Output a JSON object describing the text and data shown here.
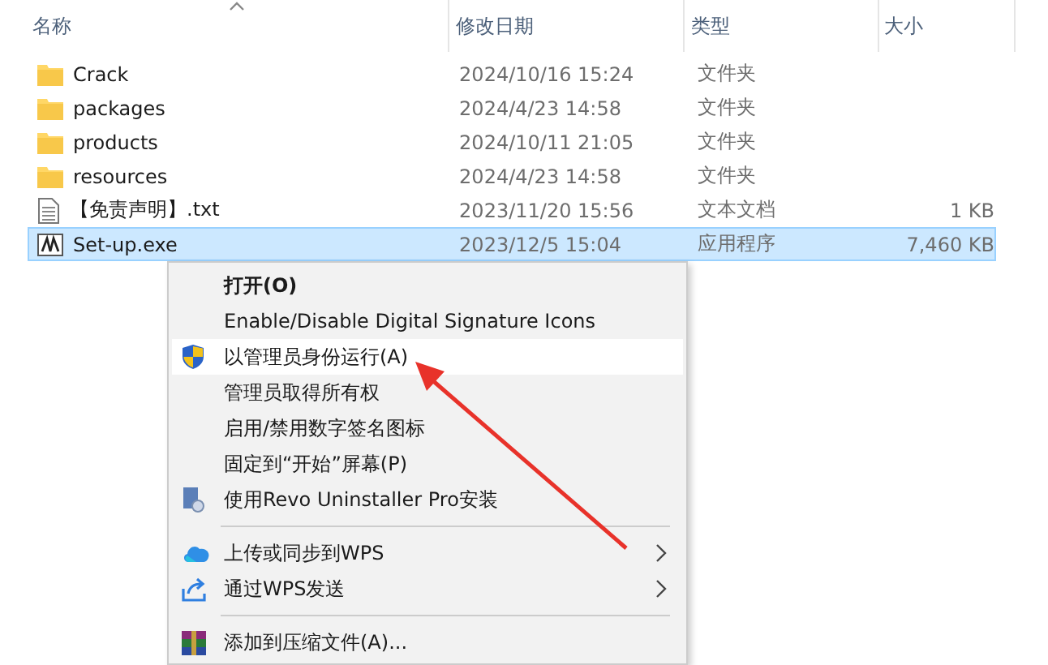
{
  "columns": [
    {
      "label": "名称",
      "sorted": true
    },
    {
      "label": "修改日期",
      "sorted": false
    },
    {
      "label": "类型",
      "sorted": false
    },
    {
      "label": "大小",
      "sorted": false
    }
  ],
  "files": [
    {
      "name": "Crack",
      "date": "2024/10/16 15:24",
      "type": "文件夹",
      "kind": "folder",
      "selected": false
    },
    {
      "name": "packages",
      "date": "2024/4/23 14:58",
      "type": "文件夹",
      "kind": "folder",
      "selected": false
    },
    {
      "name": "products",
      "date": "2024/10/11 21:05",
      "type": "文件夹",
      "kind": "folder",
      "selected": false
    },
    {
      "name": "resources",
      "date": "2024/4/23 14:58",
      "type": "文件夹",
      "kind": "folder",
      "selected": false
    },
    {
      "name": "【免责声明】.txt",
      "date": "2023/11/20 15:56",
      "type": "文本文档",
      "size": "1 KB",
      "kind": "text",
      "selected": false
    },
    {
      "name": "Set-up.exe",
      "date": "2023/12/5 15:04",
      "type": "应用程序",
      "size": "7,460 KB",
      "kind": "app",
      "selected": true
    }
  ],
  "context_menu": {
    "items": [
      {
        "kind": "plain",
        "label": "打开(O)",
        "bold": true,
        "selected": false
      },
      {
        "kind": "plain",
        "label": "Enable/Disable Digital Signature Icons",
        "bold": false,
        "selected": false
      },
      {
        "kind": "shield",
        "label": "以管理员身份运行(A)",
        "bold": false,
        "selected": true
      },
      {
        "kind": "plain",
        "label": "管理员取得所有权",
        "bold": false,
        "selected": false
      },
      {
        "kind": "plain",
        "label": "启用/禁用数字签名图标",
        "bold": false,
        "selected": false
      },
      {
        "kind": "plain",
        "label": "固定到“开始”屏幕(P)",
        "bold": false,
        "selected": false
      },
      {
        "kind": "installer",
        "label": "使用Revo Uninstaller Pro安装",
        "bold": false,
        "selected": false
      },
      {
        "kind": "separator"
      },
      {
        "kind": "cloud",
        "label": "上传或同步到WPS",
        "bold": false,
        "selected": false,
        "submenu": true
      },
      {
        "kind": "share",
        "label": "通过WPS发送",
        "bold": false,
        "selected": false,
        "submenu": true
      },
      {
        "kind": "separator"
      },
      {
        "kind": "archive",
        "label": "添加到压缩文件(A)...",
        "bold": false,
        "selected": false
      }
    ]
  },
  "annotation": {
    "kind": "arrow"
  }
}
